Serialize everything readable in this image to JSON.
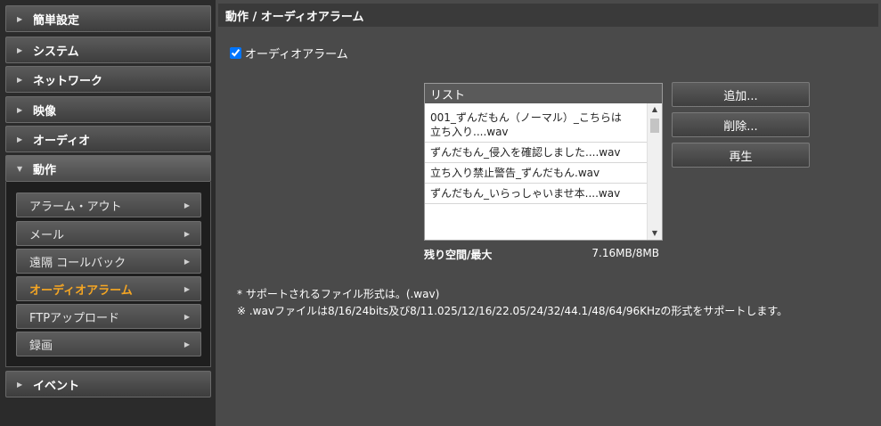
{
  "sidebar": {
    "items": [
      {
        "label": "簡単設定"
      },
      {
        "label": "システム"
      },
      {
        "label": "ネットワーク"
      },
      {
        "label": "映像"
      },
      {
        "label": "オーディオ"
      },
      {
        "label": "動作"
      },
      {
        "label": "イベント"
      }
    ],
    "submenu": [
      {
        "label": "アラーム・アウト"
      },
      {
        "label": "メール"
      },
      {
        "label": "遠隔 コールバック"
      },
      {
        "label": "オーディオアラーム"
      },
      {
        "label": "FTPアップロード"
      },
      {
        "label": "録画"
      }
    ]
  },
  "main": {
    "title": "動作 / オーディオアラーム",
    "enable_label": "オーディオアラーム",
    "list_header": "リスト",
    "list_items": [
      "001_ずんだもん（ノーマル）_こちらは　立ち入り....wav",
      "ずんだもん_侵入を確認しました....wav",
      "立ち入り禁止警告_ずんだもん.wav",
      "ずんだもん_いらっしゃいませ本....wav"
    ],
    "space_label": "残り空間/最大",
    "space_value": "7.16MB/8MB",
    "buttons": {
      "add": "追加...",
      "delete": "削除...",
      "play": "再生"
    },
    "note1": "* サポートされるファイル形式は。(.wav)",
    "note2": "※ .wavファイルは8/16/24bits及び8/11.025/12/16/22.05/24/32/44.1/48/64/96KHzの形式をサポートします。"
  }
}
